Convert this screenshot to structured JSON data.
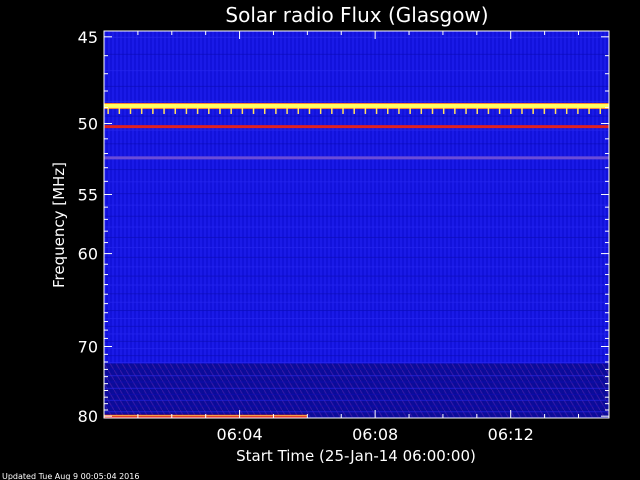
{
  "chart_data": {
    "type": "heatmap",
    "title": "Solar radio Flux (Glasgow)",
    "xlabel": "Start Time (25-Jan-14 06:00:00)",
    "ylabel": "Frequency [MHz]",
    "y_tick_labels": [
      "45",
      "50",
      "55",
      "60",
      "70",
      "80"
    ],
    "y_tick_values": [
      45,
      50,
      55,
      60,
      70,
      80
    ],
    "x_tick_labels": [
      "06:04",
      "06:08",
      "06:12"
    ],
    "x_tick_minutes": [
      4,
      8,
      12
    ],
    "x_range_minutes": [
      0,
      14.9
    ],
    "y_range_mhz": [
      44.7,
      80.3
    ],
    "colors": {
      "background": "#1414e6",
      "strong_band": "#ffff60",
      "red_band": "#e02020",
      "lower_texture": "#0a0a8c"
    },
    "features": [
      {
        "label": "persistent interference",
        "freq_mhz": 48.9,
        "intensity": "high"
      },
      {
        "label": "persistent interference",
        "freq_mhz": 50.2,
        "intensity": "medium"
      },
      {
        "label": "narrowband line",
        "freq_mhz": 52.3,
        "intensity": "low"
      },
      {
        "label": "burst strip",
        "freq_mhz": 80.0,
        "start_min": 0,
        "end_min": 6.0,
        "intensity": "high"
      }
    ]
  },
  "footer": {
    "updated": "Updated Tue Aug  9 00:05:04 2016"
  }
}
